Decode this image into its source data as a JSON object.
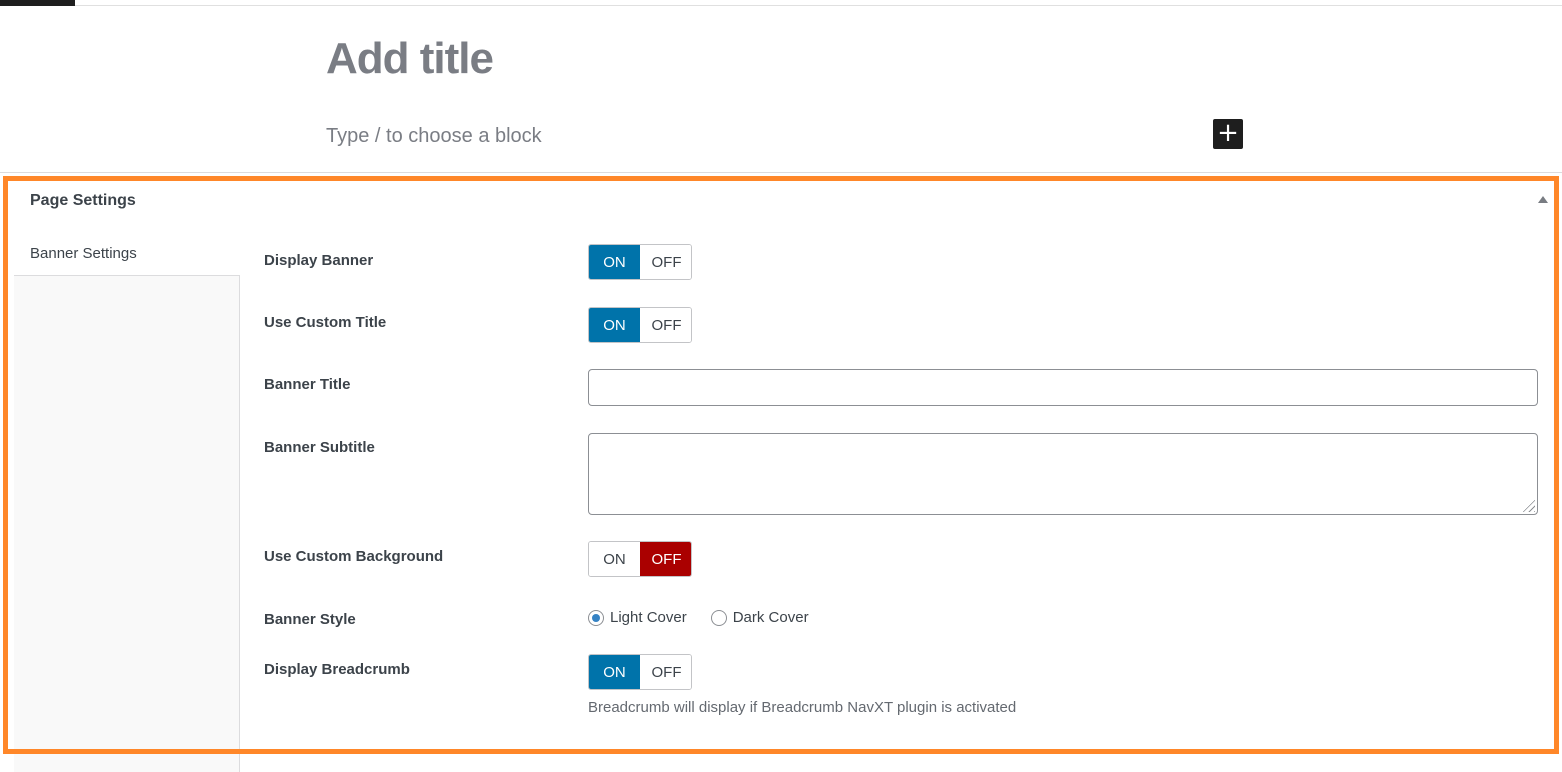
{
  "editor": {
    "title_placeholder": "Add title",
    "block_placeholder": "Type / to choose a block",
    "add_block_icon": "plus-icon"
  },
  "metabox": {
    "title": "Page Settings",
    "collapse_icon": "triangle-up-icon",
    "tabs": [
      {
        "label": "Banner Settings",
        "active": true
      }
    ],
    "fields": {
      "display_banner": {
        "label": "Display Banner",
        "on": "ON",
        "off": "OFF",
        "value": "ON"
      },
      "use_custom_title": {
        "label": "Use Custom Title",
        "on": "ON",
        "off": "OFF",
        "value": "ON"
      },
      "banner_title": {
        "label": "Banner Title",
        "value": ""
      },
      "banner_subtitle": {
        "label": "Banner Subtitle",
        "value": ""
      },
      "use_custom_background": {
        "label": "Use Custom Background",
        "on": "ON",
        "off": "OFF",
        "value": "OFF"
      },
      "banner_style": {
        "label": "Banner Style",
        "options": [
          "Light Cover",
          "Dark Cover"
        ],
        "value": "Light Cover"
      },
      "display_breadcrumb": {
        "label": "Display Breadcrumb",
        "on": "ON",
        "off": "OFF",
        "value": "ON",
        "hint": "Breadcrumb will display if Breadcrumb NavXT plugin is activated"
      }
    }
  },
  "colors": {
    "highlight": "#ff8729",
    "toggle_on": "#0073aa",
    "toggle_off": "#aa0000"
  }
}
